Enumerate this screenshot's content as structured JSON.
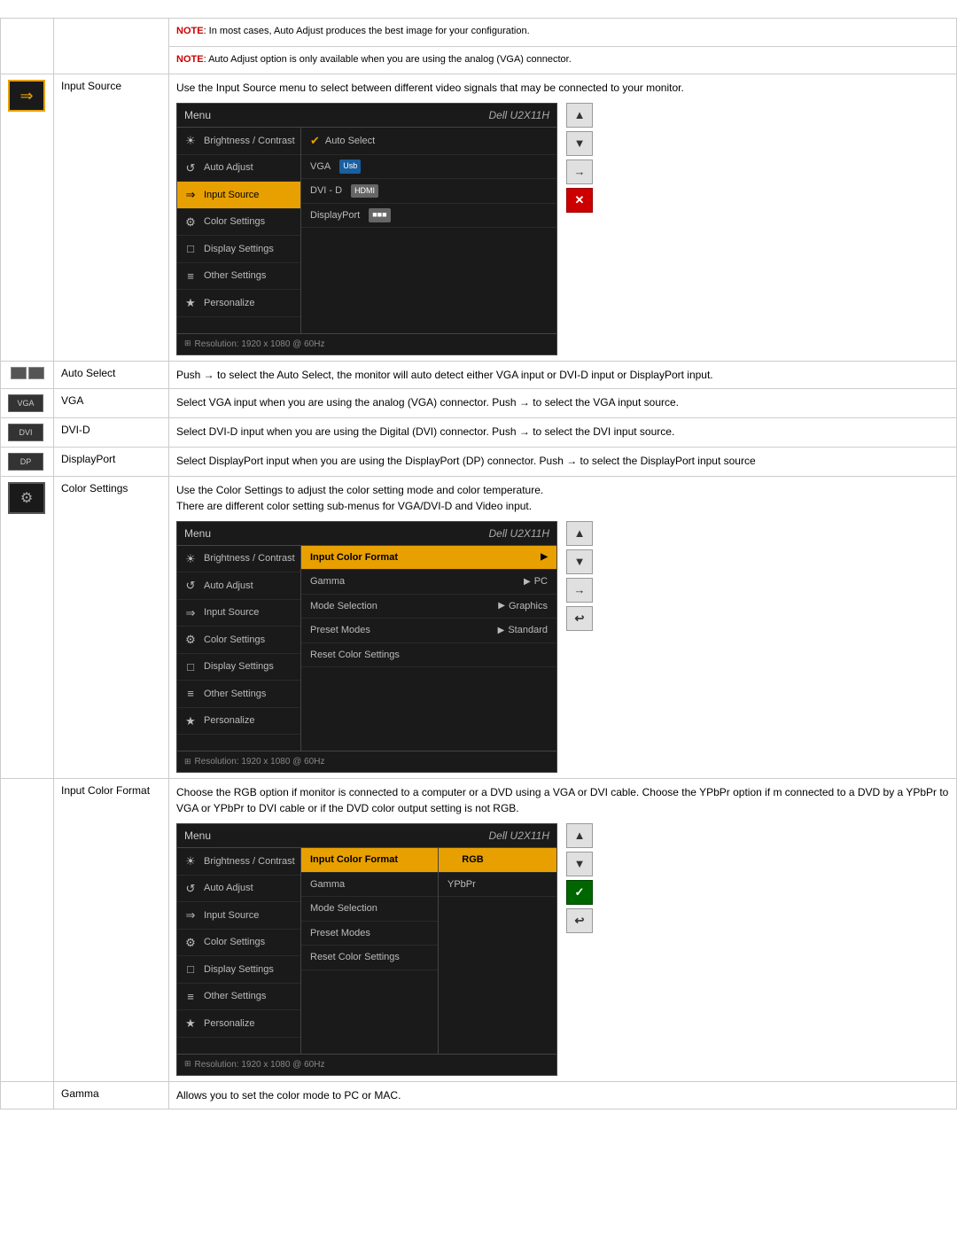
{
  "notes": [
    "NOTE: In most cases, Auto Adjust produces the best image for your configuration.",
    "NOTE: Auto Adjust option is only available when you are using the analog (VGA) connector."
  ],
  "sections": [
    {
      "id": "input-source",
      "icon_symbol": "⇒",
      "icon_style": "arrow",
      "label": "Input Source",
      "description": "Use the Input Source menu to select between different video signals that may be connected to your monitor.",
      "osd": {
        "title": "Menu",
        "model": "Dell U2X11H",
        "left_items": [
          {
            "icon": "☀",
            "label": "Brightness / Contrast",
            "active": false
          },
          {
            "icon": "↺",
            "label": "Auto Adjust",
            "active": false
          },
          {
            "icon": "⇒",
            "label": "Input Source",
            "active": true
          },
          {
            "icon": "●",
            "label": "Color Settings",
            "active": false
          },
          {
            "icon": "□",
            "label": "Display Settings",
            "active": false
          },
          {
            "icon": "≡",
            "label": "Other Settings",
            "active": false
          },
          {
            "icon": "★",
            "label": "Personalize",
            "active": false
          }
        ],
        "right_items": [
          {
            "label": "Auto Select",
            "check": true,
            "badge": null,
            "active": false
          },
          {
            "label": "VGA",
            "badge": "Usb",
            "badge_type": "blue",
            "active": false
          },
          {
            "label": "DVI - D",
            "badge": "HDMI",
            "badge_type": "gray",
            "active": false
          },
          {
            "label": "DisplayPort",
            "badge": "■■■",
            "badge_type": "gray",
            "active": false
          }
        ],
        "footer": "Resolution: 1920 x 1080 @ 60Hz"
      },
      "nav_buttons": [
        "▲",
        "▼",
        "→",
        "✕"
      ]
    },
    {
      "id": "auto-select",
      "label": "Auto Select",
      "description": "Push → to select the Auto Select, the monitor will auto detect either VGA input or DVI-D input or DisplayPort input."
    },
    {
      "id": "vga",
      "label": "VGA",
      "description": "Select VGA input when you are using the analog (VGA) connector. Push → to select the VGA input source."
    },
    {
      "id": "dvi-d",
      "label": "DVI-D",
      "description": "Select DVI-D input when you are using the Digital (DVI) connector. Push → to select the DVI input source."
    },
    {
      "id": "displayport",
      "label": "DisplayPort",
      "description": "Select DisplayPort input when you are using the DisplayPort (DP) connector. Push → to select the DisplayPort input source"
    },
    {
      "id": "color-settings",
      "icon_symbol": "●●",
      "label": "Color Settings",
      "description1": "Use the Color Settings to adjust the color setting mode and color temperature.",
      "description2": "There are different color setting sub-menus for VGA/DVI-D and Video input.",
      "osd": {
        "title": "Menu",
        "model": "Dell U2X11H",
        "left_items": [
          {
            "icon": "☀",
            "label": "Brightness / Contrast",
            "active": false
          },
          {
            "icon": "↺",
            "label": "Auto Adjust",
            "active": false
          },
          {
            "icon": "⇒",
            "label": "Input Source",
            "active": false
          },
          {
            "icon": "●",
            "label": "Color Settings",
            "active": false
          },
          {
            "icon": "□",
            "label": "Display Settings",
            "active": false
          },
          {
            "icon": "≡",
            "label": "Other Settings",
            "active": false
          },
          {
            "icon": "★",
            "label": "Personalize",
            "active": false
          }
        ],
        "sub_items": [
          {
            "label": "Input Color Format",
            "value": null,
            "active": true
          },
          {
            "label": "Gamma",
            "value": "PC",
            "active": false
          },
          {
            "label": "Mode Selection",
            "value": "Graphics",
            "active": false
          },
          {
            "label": "Preset Modes",
            "value": "Standard",
            "active": false
          },
          {
            "label": "Reset Color Settings",
            "value": null,
            "active": false
          }
        ],
        "footer": "Resolution: 1920 x 1080 @ 60Hz"
      },
      "nav_buttons": [
        "▲",
        "▼",
        "→",
        "↩"
      ]
    },
    {
      "id": "input-color-format",
      "label": "Input Color Format",
      "description": "Choose the RGB option if monitor is connected to a computer or a DVD using a VGA or DVI cable. Choose the YPbPr option if m connected to a DVD by a YPbPr to VGA or YPbPr to DVI cable or if the DVD color output setting is not RGB.",
      "osd": {
        "title": "Menu",
        "model": "Dell U2X11H",
        "left_items": [
          {
            "icon": "☀",
            "label": "Brightness / Contrast",
            "active": false
          },
          {
            "icon": "↺",
            "label": "Auto Adjust",
            "active": false
          },
          {
            "icon": "⇒",
            "label": "Input Source",
            "active": false
          },
          {
            "icon": "●",
            "label": "Color Settings",
            "active": false
          },
          {
            "icon": "□",
            "label": "Display Settings",
            "active": false
          },
          {
            "icon": "≡",
            "label": "Other Settings",
            "active": false
          },
          {
            "icon": "★",
            "label": "Personalize",
            "active": false
          }
        ],
        "sub_items": [
          {
            "label": "Input Color Format",
            "value": null,
            "active": false
          },
          {
            "label": "Gamma",
            "value": null,
            "active": false
          },
          {
            "label": "Mode Selection",
            "value": null,
            "active": false
          },
          {
            "label": "Preset Modes",
            "value": null,
            "active": false
          },
          {
            "label": "Reset Color Settings",
            "value": null,
            "active": false
          }
        ],
        "value_items": [
          {
            "label": "RGB",
            "check": true,
            "active": true
          },
          {
            "label": "YPbPr",
            "check": false,
            "active": false
          }
        ],
        "footer": "Resolution: 1920 x 1080 @ 60Hz"
      },
      "nav_buttons": [
        "▲",
        "▼",
        "✓",
        "↩"
      ]
    },
    {
      "id": "gamma",
      "label": "Gamma",
      "description": "Allows you to set the color mode to PC or MAC."
    }
  ],
  "ui": {
    "note_label": "NOTE",
    "menu_label": "Menu",
    "model_name": "Dell U2X11H"
  }
}
